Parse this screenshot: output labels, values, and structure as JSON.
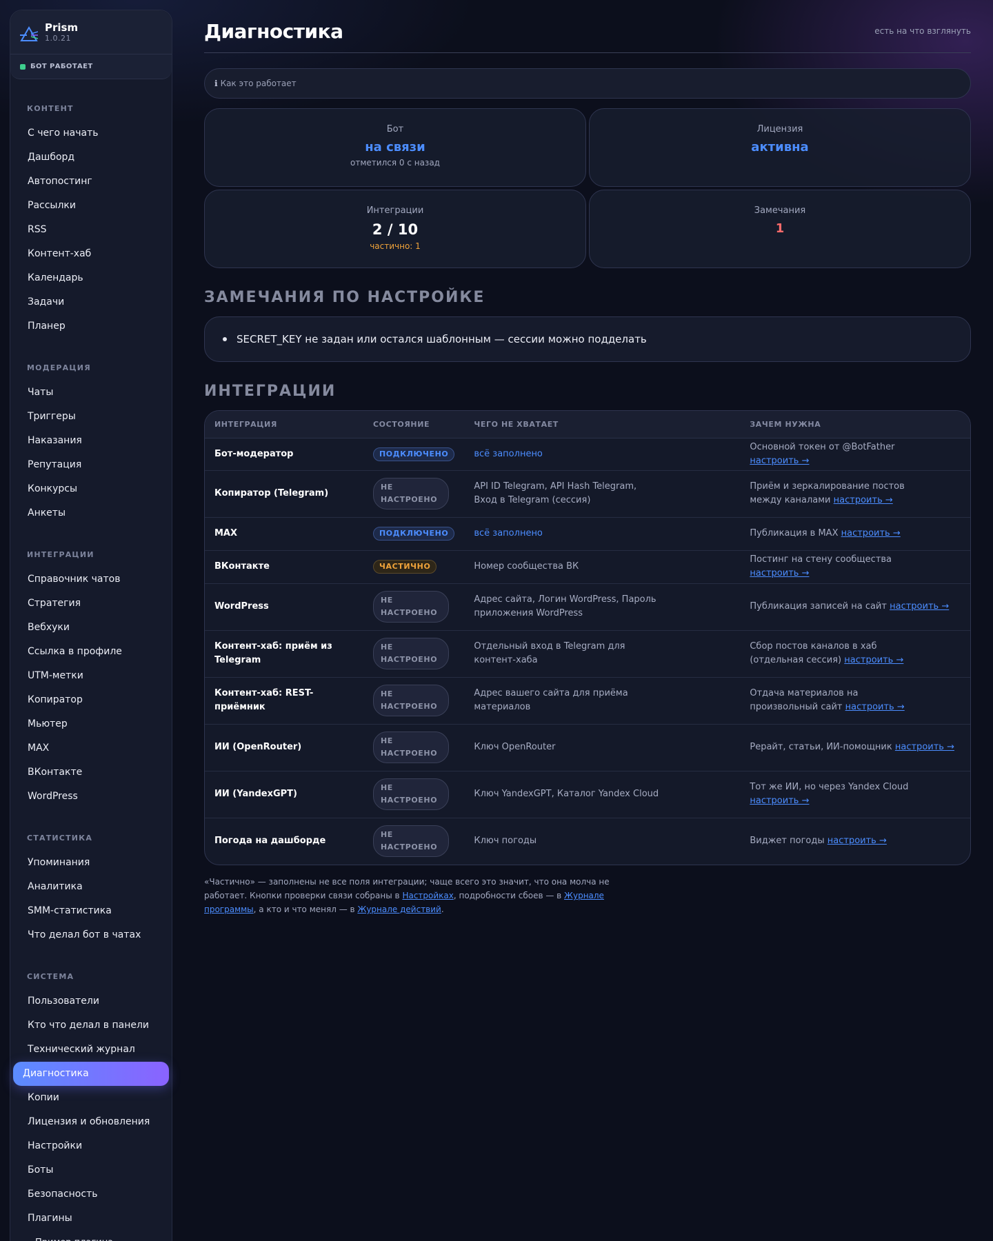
{
  "brand": {
    "name": "Prism",
    "version": "1.0.21"
  },
  "bot_status": "БОТ РАБОТАЕТ",
  "nav": [
    {
      "title": "КОНТЕНТ",
      "items": [
        "С чего начать",
        "Дашборд",
        "Автопостинг",
        "Рассылки",
        "RSS",
        "Контент-хаб",
        "Календарь",
        "Задачи",
        "Планер"
      ]
    },
    {
      "title": "МОДЕРАЦИЯ",
      "items": [
        "Чаты",
        "Триггеры",
        "Наказания",
        "Репутация",
        "Конкурсы",
        "Анкеты"
      ]
    },
    {
      "title": "ИНТЕГРАЦИИ",
      "items": [
        "Справочник чатов",
        "Стратегия",
        "Вебхуки",
        "Ссылка в профиле",
        "UTM-метки",
        "Копиратор",
        "Мьютер",
        "MAX",
        "ВКонтакте",
        "WordPress"
      ]
    },
    {
      "title": "СТАТИСТИКА",
      "items": [
        "Упоминания",
        "Аналитика",
        "SMM-статистика",
        "Что делал бот в чатах"
      ]
    },
    {
      "title": "СИСТЕМА",
      "items": [
        "Пользователи",
        "Кто что делал в панели",
        "Технический журнал",
        "Диагностика",
        "Копии",
        "Лицензия и обновления",
        "Настройки",
        "Боты",
        "Безопасность",
        "Плагины",
        "Пример плагина"
      ]
    }
  ],
  "active_item": "Диагностика",
  "header": {
    "title": "Диагностика",
    "hint": "есть на что взглянуть"
  },
  "howto": {
    "icon": "info-icon",
    "label": "Как это работает"
  },
  "stats": {
    "bot": {
      "label": "Бот",
      "value": "на связи",
      "sub": "отметился 0 с назад"
    },
    "license": {
      "label": "Лицензия",
      "value": "активна"
    },
    "integrations": {
      "label": "Интеграции",
      "value": "2 / 10",
      "sub": "частично: 1"
    },
    "issues": {
      "label": "Замечания",
      "value": "1"
    }
  },
  "issues_section": {
    "title": "ЗАМЕЧАНИЯ ПО НАСТРОЙКЕ",
    "items": [
      "SECRET_KEY не задан или остался шаблонным — сессии можно подделать"
    ]
  },
  "integrations_section": {
    "title": "ИНТЕГРАЦИИ",
    "columns": [
      "ИНТЕГРАЦИЯ",
      "СОСТОЯНИЕ",
      "ЧЕГО НЕ ХВАТАЕТ",
      "ЗАЧЕМ НУЖНА"
    ],
    "link_label": "настроить →",
    "rows": [
      {
        "name": "Бот-модератор",
        "status": "ПОДКЛЮЧЕНО",
        "kind": "ok",
        "missing": "всё заполнено",
        "purpose": "Основной токен от @BotFather"
      },
      {
        "name": "Копиратор (Telegram)",
        "status": "НЕ НАСТРОЕНО",
        "kind": "none",
        "missing": "API ID Telegram, API Hash Telegram, Вход в Telegram (сессия)",
        "purpose": "Приём и зеркалирование постов между каналами"
      },
      {
        "name": "MAX",
        "status": "ПОДКЛЮЧЕНО",
        "kind": "ok",
        "missing": "всё заполнено",
        "purpose": "Публикация в MAX"
      },
      {
        "name": "ВКонтакте",
        "status": "ЧАСТИЧНО",
        "kind": "partial",
        "missing": "Номер сообщества ВК",
        "purpose": "Постинг на стену сообщества"
      },
      {
        "name": "WordPress",
        "status": "НЕ НАСТРОЕНО",
        "kind": "none",
        "missing": "Адрес сайта, Логин WordPress, Пароль приложения WordPress",
        "purpose": "Публикация записей на сайт"
      },
      {
        "name": "Контент-хаб: приём из Telegram",
        "status": "НЕ НАСТРОЕНО",
        "kind": "none",
        "missing": "Отдельный вход в Telegram для контент-хаба",
        "purpose": "Сбор постов каналов в хаб (отдельная сессия)"
      },
      {
        "name": "Контент-хаб: REST-приёмник",
        "status": "НЕ НАСТРОЕНО",
        "kind": "none",
        "missing": "Адрес вашего сайта для приёма материалов",
        "purpose": "Отдача материалов на произвольный сайт"
      },
      {
        "name": "ИИ (OpenRouter)",
        "status": "НЕ НАСТРОЕНО",
        "kind": "none",
        "missing": "Ключ OpenRouter",
        "purpose": "Рерайт, статьи, ИИ-помощник"
      },
      {
        "name": "ИИ (YandexGPT)",
        "status": "НЕ НАСТРОЕНО",
        "kind": "none",
        "missing": "Ключ YandexGPT, Каталог Yandex Cloud",
        "purpose": "Тот же ИИ, но через Yandex Cloud"
      },
      {
        "name": "Погода на дашборде",
        "status": "НЕ НАСТРОЕНО",
        "kind": "none",
        "missing": "Ключ погоды",
        "purpose": "Виджет погоды"
      }
    ]
  },
  "footnote": {
    "part1": "«Частично» — заполнены не все поля интеграции; чаще всего это значит, что она молча не работает. Кнопки проверки связи собраны в ",
    "link1": "Настройках",
    "part2": ", подробности сбоев — в ",
    "link2": "Журнале программы",
    "part3": ", а кто и что менял — в ",
    "link3": "Журнале действий",
    "part4": "."
  },
  "colors": {
    "accent": "#4c8dff",
    "active_from": "#5b8cff",
    "active_to": "#8a63ff",
    "ok": "#3ecf8e",
    "warn": "#f0a33a",
    "danger": "#ff6b6b"
  }
}
